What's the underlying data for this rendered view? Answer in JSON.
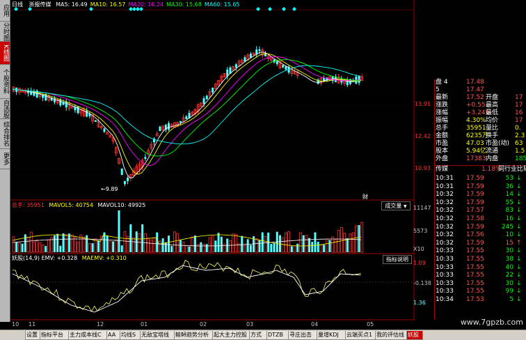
{
  "left_sidebar": {
    "items": [
      {
        "label": "应用",
        "active": false
      },
      {
        "label": "分时图",
        "active": false
      },
      {
        "label": "K线图",
        "active": true
      },
      {
        "label": "个股资料",
        "active": false
      },
      {
        "label": "自选股",
        "active": false
      },
      {
        "label": "综合排名",
        "active": false
      },
      {
        "label": "更多",
        "active": false
      }
    ]
  },
  "price_panel": {
    "period": "日线",
    "stock_name": "浙报传媒",
    "ma_labels": [
      {
        "text": "MA5: 16.49",
        "color": "#ffffff"
      },
      {
        "text": "MA10: 16.57",
        "color": "#ffff00"
      },
      {
        "text": "MA20: 16.24",
        "color": "#ff00ff"
      },
      {
        "text": "MA30: 15.68",
        "color": "#00ff00"
      },
      {
        "text": "MA60: 15.65",
        "color": "#00ffff"
      }
    ],
    "axis_labels": [
      "13.91",
      "12.42",
      "10.93"
    ],
    "low_marker": "9.89",
    "fin_marker": "财"
  },
  "volume_panel": {
    "header": [
      {
        "text": "总手: 35951",
        "color": "#ffffff"
      },
      {
        "text": "MAVOL5: 40754",
        "color": "#ffff00"
      },
      {
        "text": "MAVOL10: 49925",
        "color": "#ffffff"
      }
    ],
    "dropdown_label": "成交量",
    "axis_labels": [
      "11147",
      "5573",
      "X10"
    ]
  },
  "indicator_panel": {
    "header": [
      {
        "text": "妖股(14,9) EMV: +0.328",
        "color": "#ffffff"
      },
      {
        "text": "MAEMV: +0.310",
        "color": "#ffff00"
      }
    ],
    "help_label": "指标说明",
    "axis_labels": [
      "1.09",
      "-0.138",
      "1.36"
    ]
  },
  "date_axis": [
    "10",
    "11",
    "12",
    "01",
    "02",
    "03",
    "04",
    "05"
  ],
  "quote_panel": {
    "rows": [
      {
        "l1": "盘 4",
        "v1": "17.48",
        "l2": "",
        "v2": "",
        "c1": "#ff5555",
        "c2": "#ff5555"
      },
      {
        "l1": "5",
        "v1": "17.47",
        "l2": "",
        "v2": "",
        "c1": "#ff5555",
        "c2": "#ff5555"
      },
      {
        "l1": "最新",
        "v1": "17.52",
        "l2": "开盘",
        "v2": "17",
        "c1": "#ff5555",
        "c2": "#ff5555"
      },
      {
        "l1": "涨跌",
        "v1": "+0.55",
        "l2": "最高",
        "v2": "17",
        "c1": "#ff5555",
        "c2": "#ff5555"
      },
      {
        "l1": "涨幅",
        "v1": "+3.24%",
        "l2": "最低",
        "v2": "16",
        "c1": "#ff5555",
        "c2": "#ff5555"
      },
      {
        "l1": "振幅",
        "v1": "4.30%",
        "l2": "均价",
        "v2": "17",
        "c1": "#ffff00",
        "c2": "#ff5555"
      },
      {
        "l1": "总手",
        "v1": "35951",
        "l2": "量比",
        "v2": "0.",
        "c1": "#ffff00",
        "c2": "#ffff00"
      },
      {
        "l1": "金额",
        "v1": "6235万",
        "l2": "换手",
        "v2": "2.3",
        "c1": "#ffff00",
        "c2": "#ffff00"
      },
      {
        "l1": "市盈",
        "v1": "47.03",
        "l2": "市盈(动)",
        "v2": "63",
        "c1": "#ffff00",
        "c2": "#ffff00"
      },
      {
        "l1": "股本",
        "v1": "5.94亿",
        "l2": "流通",
        "v2": "1.5",
        "c1": "#ffff00",
        "c2": "#ffff00"
      },
      {
        "l1": "外盘",
        "v1": "17383",
        "l2": "内盘",
        "v2": "185",
        "c1": "#ff5555",
        "c2": "#00ff00"
      }
    ],
    "sub_header": {
      "left": "传媒",
      "mid": "1.18%",
      "right": "同行业比较"
    }
  },
  "ticks": [
    {
      "time": "10:31",
      "price": "17.59",
      "vol": "53",
      "dir": "down"
    },
    {
      "time": "10:31",
      "price": "17.59",
      "vol": "36",
      "dir": "down"
    },
    {
      "time": "10:32",
      "price": "17.59",
      "vol": "14",
      "dir": "down"
    },
    {
      "time": "10:32",
      "price": "17.59",
      "vol": "55",
      "dir": "down"
    },
    {
      "time": "10:32",
      "price": "17.57",
      "vol": "83",
      "dir": "down"
    },
    {
      "time": "10:32",
      "price": "17.58",
      "vol": "16",
      "dir": "down"
    },
    {
      "time": "10:32",
      "price": "17.59",
      "vol": "245",
      "dir": "down"
    },
    {
      "time": "10:32",
      "price": "17.56",
      "vol": "10",
      "dir": "down"
    },
    {
      "time": "10:32",
      "price": "17.59",
      "vol": "15",
      "dir": "up"
    },
    {
      "time": "10:33",
      "price": "17.55",
      "vol": "30",
      "dir": "down"
    },
    {
      "time": "10:33",
      "price": "17.55",
      "vol": "38",
      "dir": "down"
    },
    {
      "time": "10:33",
      "price": "17.55",
      "vol": "40",
      "dir": "down"
    },
    {
      "time": "10:33",
      "price": "17.55",
      "vol": "22",
      "dir": "down"
    },
    {
      "time": "10:33",
      "price": "17.55",
      "vol": "30",
      "dir": "down"
    },
    {
      "time": "10:33",
      "price": "17.55",
      "vol": "99",
      "dir": "down"
    },
    {
      "time": "10:34",
      "price": "17.53",
      "vol": "5",
      "dir": "down"
    }
  ],
  "bottom_tabs": [
    {
      "label": "设置",
      "active": false
    },
    {
      "label": "指标平台",
      "active": false
    },
    {
      "label": "主力成本线C",
      "active": false
    },
    {
      "label": "AA",
      "active": false
    },
    {
      "label": "均线S",
      "active": false
    },
    {
      "label": "无敌宝塔线",
      "active": false
    },
    {
      "label": "鲸鲟趋势分析",
      "active": false
    },
    {
      "label": "起大主力控股",
      "active": false
    },
    {
      "label": "方式",
      "active": false
    },
    {
      "label": "DTZB",
      "active": false
    },
    {
      "label": "寻庄出击",
      "active": false
    },
    {
      "label": "量增KDJ",
      "active": false
    },
    {
      "label": "云端买点1",
      "active": false
    },
    {
      "label": "我的评估线",
      "active": false
    },
    {
      "label": "妖股",
      "active": true
    }
  ],
  "watermark": "www.7gpzb.com",
  "colors": {
    "up": "#ff3232",
    "down": "#54ffff",
    "frame": "#a00000"
  }
}
